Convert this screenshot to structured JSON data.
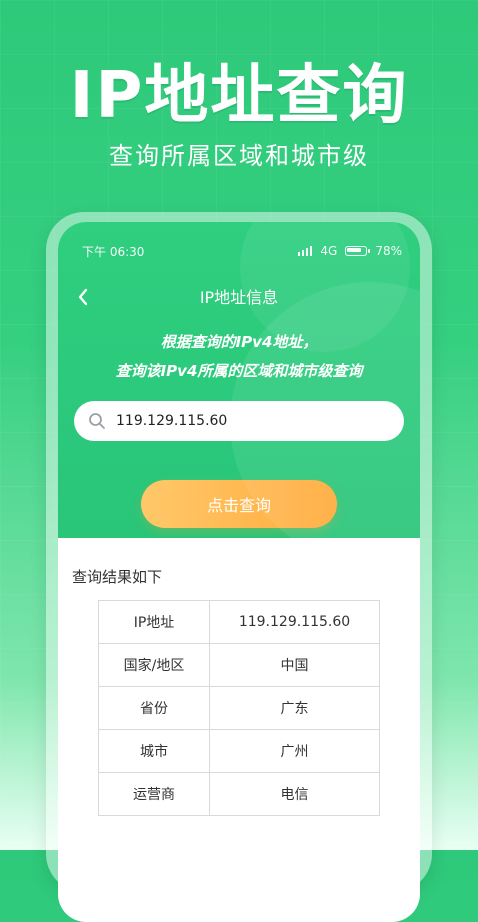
{
  "hero": {
    "title": "IP地址查询",
    "subtitle": "查询所属区域和城市级"
  },
  "status_bar": {
    "time": "下午 06:30",
    "network": "4G",
    "battery": "78%"
  },
  "nav": {
    "title": "IP地址信息"
  },
  "description": {
    "line1": "根据查询的IPv4地址，",
    "line2": "查询该IPv4所属的区域和城市级查询"
  },
  "search": {
    "value": "119.129.115.60"
  },
  "actions": {
    "query_label": "点击查询"
  },
  "results": {
    "title": "查询结果如下",
    "rows": [
      {
        "label": "IP地址",
        "value": "119.129.115.60"
      },
      {
        "label": "国家/地区",
        "value": "中国"
      },
      {
        "label": "省份",
        "value": "广东"
      },
      {
        "label": "城市",
        "value": "广州"
      },
      {
        "label": "运营商",
        "value": "电信"
      }
    ]
  },
  "colors": {
    "primary_green": "#2fcf7f",
    "button_orange": "#ffab3b",
    "text_dark": "#333333"
  },
  "icons": {
    "back": "chevron-left-icon",
    "search": "search-icon",
    "signal": "signal-icon",
    "battery": "battery-icon"
  }
}
